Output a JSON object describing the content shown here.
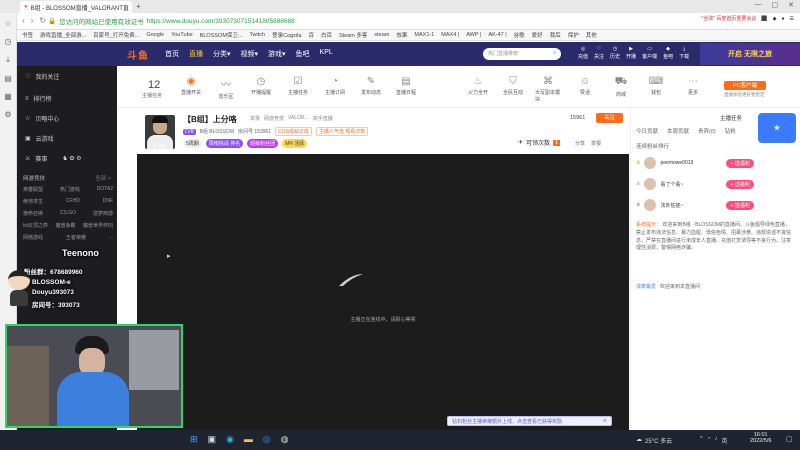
{
  "browser": {
    "tab_title": "B组 - BLOSSOM直播_VALORANT直",
    "url_security": "您访问的网站已使用有效证书",
    "url": "https://www.douyu.com/3930730715141805888688",
    "ext_labels": [
      "\"全球\" 百度首页重要会议",
      "5",
      "7",
      "9"
    ],
    "bookmarks": [
      "书签",
      "游戏直播_全部游...",
      "百家号_打开免费...",
      "Google",
      "YouTube",
      "BLOSSOM保卫...",
      "Twitch",
      "登录Cogxila",
      "百",
      "白百",
      "Steam 多客",
      "steam",
      "效果",
      "MAX1-1",
      "MAX4 |",
      "AWP |",
      "AK-47 |",
      "谷歌",
      "爱好",
      "我后",
      "保护",
      "其他"
    ]
  },
  "top_nav": {
    "logo": "斗鱼",
    "items": [
      {
        "label": "首页",
        "active": false
      },
      {
        "label": "直播",
        "active": true
      },
      {
        "label": "分类▾",
        "active": false
      },
      {
        "label": "视频▾",
        "active": false
      },
      {
        "label": "游戏▾",
        "active": false
      },
      {
        "label": "鱼吧",
        "active": false
      },
      {
        "label": "KPL",
        "active": false
      }
    ],
    "search_placeholder": "热门直播推荐",
    "right_icons": [
      "充值",
      "关注",
      "历史",
      "开播",
      "客户端",
      "鱼吧",
      "下载"
    ],
    "promo": "开启 无限之旅"
  },
  "sidebar": {
    "items": [
      {
        "icon": "heart-icon",
        "label": "我的关注"
      },
      {
        "icon": "list-icon",
        "label": "排行榜"
      },
      {
        "icon": "star-icon",
        "label": "贝略中心"
      },
      {
        "icon": "gift-icon",
        "label": "云游戏"
      },
      {
        "icon": "game-icon",
        "label": "赛事"
      }
    ],
    "section_title": "网游竞技",
    "section_more": "全部 >",
    "grid": [
      [
        "英雄联盟",
        "热门游戏",
        "DOTA2"
      ],
      [
        "绝地求生",
        "CFHD",
        "DNF"
      ],
      [
        "使命召唤",
        "CS:GO",
        "造梦西游"
      ],
      [
        "lol云顶之弈",
        "魔兽争霸",
        "魔兽世界怀旧"
      ],
      [
        "网络游戏",
        "王者荣耀",
        "..."
      ]
    ]
  },
  "categories": [
    {
      "icon": "count-icon",
      "label": "主播任务",
      "badge": "12"
    },
    {
      "icon": "badge-icon",
      "label": "直播开关",
      "badge": "1"
    },
    {
      "icon": "wave-icon",
      "label": "音乐区"
    },
    {
      "icon": "clock-icon",
      "label": "开播提醒"
    },
    {
      "icon": "task-icon",
      "label": "主播任务"
    },
    {
      "icon": "chat-icon",
      "label": "主播订阅"
    },
    {
      "icon": "edit-icon",
      "label": "发布动态"
    },
    {
      "icon": "doc-icon",
      "label": "直播日程"
    },
    {
      "icon": "fire-icon",
      "label": "火力全开"
    },
    {
      "icon": "shield-icon",
      "label": "全民互动"
    },
    {
      "icon": "gift-icon",
      "label": "大写副本模块"
    },
    {
      "icon": "like-icon",
      "label": "赞话"
    },
    {
      "icon": "shop-icon",
      "label": "商城"
    },
    {
      "icon": "ticket-icon",
      "label": "钱包"
    },
    {
      "icon": "more-icon",
      "label": "更多"
    }
  ],
  "pc_client": {
    "label": "PC客户端",
    "sub": "直播体验更好更稳定"
  },
  "streamer": {
    "name_tag": "【B组】上分咯",
    "level": "LV8",
    "room_label": "B组 BLOSSOM",
    "room_id": "房间号 153961",
    "report": "举报",
    "category": "网游竞技",
    "game": "VALOR...",
    "sub_category": "高手直播",
    "tags": [
      "COS成就达成",
      "主播人气值 观看次数"
    ],
    "badges": [
      "5周期",
      "周榜挑战 排名",
      "超级粉丝团",
      "MR 活跃"
    ],
    "follow_count": "15961",
    "follow_label": "关注",
    "share": "分享",
    "report_btn": "举报",
    "watch_count_label": "可领次数",
    "watch_count": "1",
    "caption": "上分咯"
  },
  "video": {
    "status": "主播正在连线中，请耐心等候",
    "hint": "钻石粉丝主播荣耀额外上线，点击查看已获得奖励"
  },
  "chat": {
    "tabs": [
      "今日贡献",
      "本周贡献",
      "贵宾(0)",
      "钻粉"
    ],
    "header": "主播任务",
    "rank_title": "连续粉丝排行",
    "ranks": [
      {
        "name": "peemowe0019",
        "action": "+ 送福利"
      },
      {
        "name": "看了个看~",
        "action": "+ 送福利"
      },
      {
        "name": "法外狂徒~",
        "action": "+ 送福利"
      }
    ],
    "system_label": "系统提示：",
    "system_msg": "欢迎来到B组 - BLOSSOM的直播间。斗鱼倡导绿色直播，禁止发布违法信息、暴力血腥、低俗色情、招募涉黄、违规造谣不良信息。严禁在直播间进行未成年人直播、充值打赏诱导等不良行为。注意理性消费，警惕网络诈骗。",
    "welcome_label": "欢迎来到本直播间",
    "welcome_user": "浅筑最爱"
  },
  "overlay": {
    "name": "Teenono",
    "fan_group": "粉丝群：678689960",
    "tiktok": "BLOSSOM-e",
    "douyu": "Douyu393073",
    "room": "房间号：393073"
  },
  "taskbar": {
    "weather": "25°C 多云",
    "time": "16:01",
    "date": "2022/5/6",
    "lang": "英"
  }
}
